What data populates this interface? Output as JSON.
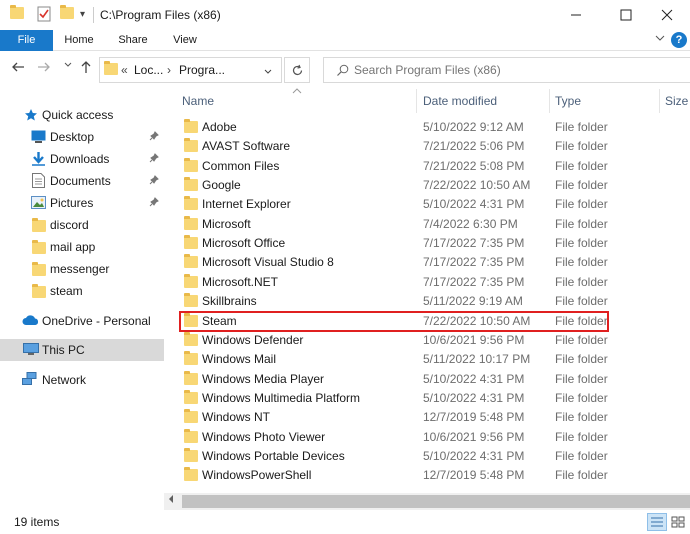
{
  "window": {
    "title": "C:\\Program Files (x86)",
    "minimize": "—",
    "maximize": "☐",
    "close": "✕"
  },
  "ribbon": {
    "tabs": [
      "File",
      "Home",
      "Share",
      "View"
    ],
    "expand": "⌄",
    "help": "?"
  },
  "address": {
    "back": "←",
    "forward": "→",
    "recent": "⌄",
    "up": "↑",
    "overflow": "«",
    "crumbs": [
      "Loc...",
      "Progra..."
    ],
    "crumb_sep": "›",
    "dropdown": "⌄",
    "refresh": "↻",
    "search_placeholder": "Search Program Files (x86)"
  },
  "nav": {
    "quick_access": "Quick access",
    "items": [
      {
        "label": "Desktop",
        "icon": "desktop-icon",
        "pinned": true
      },
      {
        "label": "Downloads",
        "icon": "download-icon",
        "pinned": true
      },
      {
        "label": "Documents",
        "icon": "documents-icon",
        "pinned": true
      },
      {
        "label": "Pictures",
        "icon": "pictures-icon",
        "pinned": true
      },
      {
        "label": "discord",
        "icon": "folder-icon",
        "pinned": false
      },
      {
        "label": "mail app",
        "icon": "folder-icon",
        "pinned": false
      },
      {
        "label": "messenger",
        "icon": "folder-icon",
        "pinned": false
      },
      {
        "label": "steam",
        "icon": "folder-icon",
        "pinned": false
      }
    ],
    "onedrive": "OneDrive - Personal",
    "this_pc": "This PC",
    "network": "Network"
  },
  "columns": {
    "name": "Name",
    "date": "Date modified",
    "type": "Type",
    "size": "Size",
    "sort_indicator": "^"
  },
  "files": [
    {
      "name": "Adobe",
      "date": "5/10/2022 9:12 AM",
      "type": "File folder"
    },
    {
      "name": "AVAST Software",
      "date": "7/21/2022 5:06 PM",
      "type": "File folder"
    },
    {
      "name": "Common Files",
      "date": "7/21/2022 5:08 PM",
      "type": "File folder"
    },
    {
      "name": "Google",
      "date": "7/22/2022 10:50 AM",
      "type": "File folder"
    },
    {
      "name": "Internet Explorer",
      "date": "5/10/2022 4:31 PM",
      "type": "File folder"
    },
    {
      "name": "Microsoft",
      "date": "7/4/2022 6:30 PM",
      "type": "File folder"
    },
    {
      "name": "Microsoft Office",
      "date": "7/17/2022 7:35 PM",
      "type": "File folder"
    },
    {
      "name": "Microsoft Visual Studio 8",
      "date": "7/17/2022 7:35 PM",
      "type": "File folder"
    },
    {
      "name": "Microsoft.NET",
      "date": "7/17/2022 7:35 PM",
      "type": "File folder"
    },
    {
      "name": "Skillbrains",
      "date": "5/11/2022 9:19 AM",
      "type": "File folder"
    },
    {
      "name": "Steam",
      "date": "7/22/2022 10:50 AM",
      "type": "File folder",
      "highlighted": true
    },
    {
      "name": "Windows Defender",
      "date": "10/6/2021 9:56 PM",
      "type": "File folder"
    },
    {
      "name": "Windows Mail",
      "date": "5/11/2022 10:17 PM",
      "type": "File folder"
    },
    {
      "name": "Windows Media Player",
      "date": "5/10/2022 4:31 PM",
      "type": "File folder"
    },
    {
      "name": "Windows Multimedia Platform",
      "date": "5/10/2022 4:31 PM",
      "type": "File folder"
    },
    {
      "name": "Windows NT",
      "date": "12/7/2019 5:48 PM",
      "type": "File folder"
    },
    {
      "name": "Windows Photo Viewer",
      "date": "10/6/2021 9:56 PM",
      "type": "File folder"
    },
    {
      "name": "Windows Portable Devices",
      "date": "5/10/2022 4:31 PM",
      "type": "File folder"
    },
    {
      "name": "WindowsPowerShell",
      "date": "12/7/2019 5:48 PM",
      "type": "File folder"
    }
  ],
  "status": {
    "item_count": "19 items"
  },
  "colors": {
    "accent": "#1979ca",
    "folder": "#f8d775",
    "highlight": "#e02020",
    "selected_nav": "#d9d9d9"
  }
}
